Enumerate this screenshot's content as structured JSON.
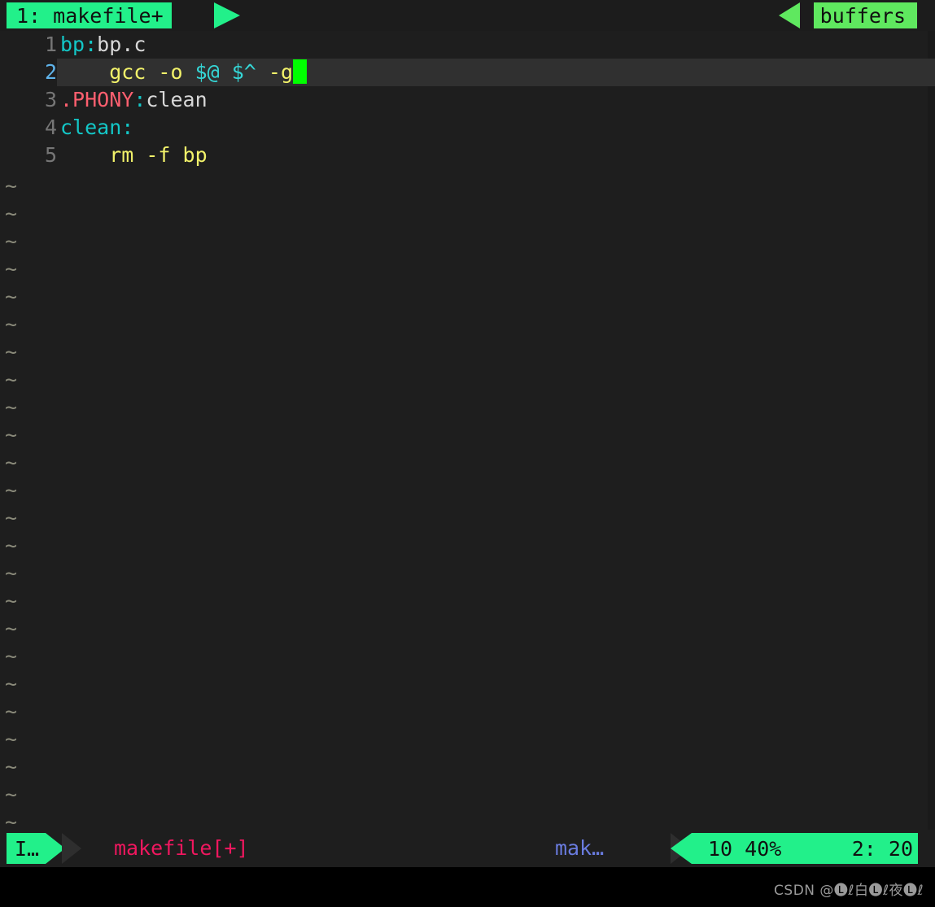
{
  "tabline": {
    "active_tab": "1: makefile+",
    "buffers_label": "buffers"
  },
  "editor": {
    "lines": [
      {
        "number": "1",
        "current": false,
        "tokens": [
          {
            "text": "bp",
            "type": "target"
          },
          {
            "text": ":",
            "type": "colon"
          },
          {
            "text": "bp.c",
            "type": "plain"
          }
        ]
      },
      {
        "number": "2",
        "current": true,
        "tokens": [
          {
            "text": "    gcc -o ",
            "type": "cmd"
          },
          {
            "text": "$@",
            "type": "var"
          },
          {
            "text": " ",
            "type": "cmd"
          },
          {
            "text": "$^",
            "type": "var"
          },
          {
            "text": " -g",
            "type": "cmd"
          }
        ]
      },
      {
        "number": "3",
        "current": false,
        "tokens": [
          {
            "text": ".PHONY",
            "type": "special"
          },
          {
            "text": ":",
            "type": "colon"
          },
          {
            "text": "clean",
            "type": "plain"
          }
        ]
      },
      {
        "number": "4",
        "current": false,
        "tokens": [
          {
            "text": "clean:",
            "type": "target"
          }
        ]
      },
      {
        "number": "5",
        "current": false,
        "tokens": [
          {
            "text": "    rm -f bp",
            "type": "cmd"
          }
        ]
      }
    ],
    "empty_marker": "~",
    "empty_marker_count": 24,
    "cursor_color": "#00ff00"
  },
  "statusline": {
    "mode": "I…",
    "file_name": "makefile[+]",
    "filetype": "mak…",
    "total_lines": "10 40%",
    "cursor_position": "2: 20"
  },
  "watermark": {
    "text": "CSDN @🅛ℓ白🅛ℓ夜🅛ℓ"
  },
  "colors": {
    "accent_green": "#22f08a",
    "buffers_green": "#5fe85f",
    "background": "#1e1e1e",
    "tabline_bg": "#1c1c1c",
    "cursor": "#00ff00",
    "file_pink": "#f0175f",
    "filetype_blue": "#6a7ce0"
  }
}
